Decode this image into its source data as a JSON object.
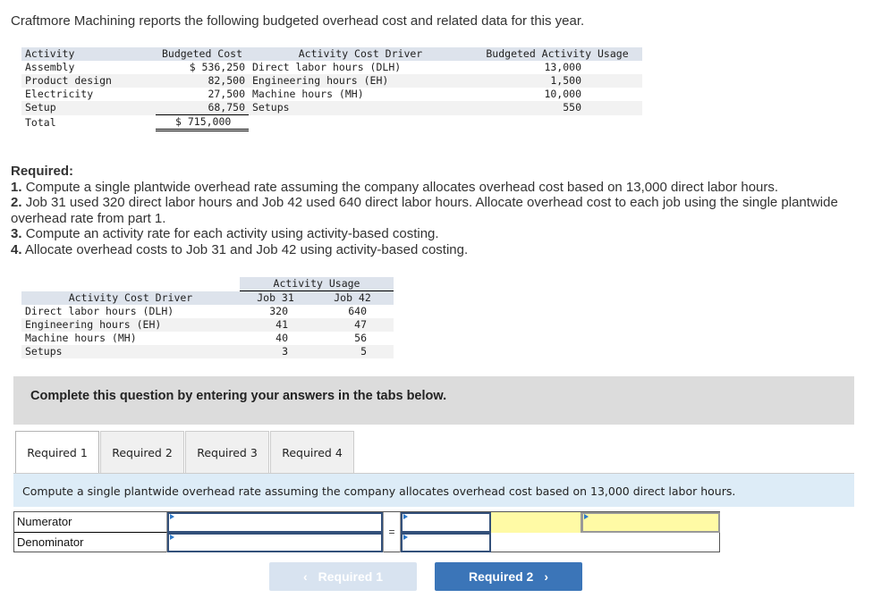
{
  "intro": "Craftmore Machining reports the following budgeted overhead cost and related data for this year.",
  "budget_table": {
    "headers": [
      "Activity",
      "Budgeted Cost",
      "Activity Cost Driver",
      "Budgeted Activity Usage"
    ],
    "rows": [
      {
        "activity": "Assembly",
        "cost": "$ 536,250",
        "driver": "Direct labor hours (DLH)",
        "usage": "13,000"
      },
      {
        "activity": "Product design",
        "cost": "82,500",
        "driver": "Engineering hours (EH)",
        "usage": "1,500"
      },
      {
        "activity": "Electricity",
        "cost": "27,500",
        "driver": "Machine hours (MH)",
        "usage": "10,000"
      },
      {
        "activity": "Setup",
        "cost": "68,750",
        "driver": "Setups",
        "usage": "550"
      }
    ],
    "total_label": "Total",
    "total_cost": "$ 715,000"
  },
  "required": {
    "heading": "Required:",
    "items": [
      {
        "num": "1.",
        "text": "Compute a single plantwide overhead rate assuming the company allocates overhead cost based on 13,000 direct labor hours."
      },
      {
        "num": "2.",
        "text": "Job 31 used 320 direct labor hours and Job 42 used 640 direct labor hours. Allocate overhead cost to each job using the single plantwide overhead rate from part 1."
      },
      {
        "num": "3.",
        "text": "Compute an activity rate for each activity using activity-based costing."
      },
      {
        "num": "4.",
        "text": "Allocate overhead costs to Job 31 and Job 42 using activity-based costing."
      }
    ]
  },
  "usage_table": {
    "group_header": "Activity Usage",
    "headers": [
      "Activity Cost Driver",
      "Job 31",
      "Job 42"
    ],
    "rows": [
      {
        "driver": "Direct labor hours (DLH)",
        "job31": "320",
        "job42": "640"
      },
      {
        "driver": "Engineering hours (EH)",
        "job31": "41",
        "job42": "47"
      },
      {
        "driver": "Machine hours (MH)",
        "job31": "40",
        "job42": "56"
      },
      {
        "driver": "Setups",
        "job31": "3",
        "job42": "5"
      }
    ]
  },
  "banner": "Complete this question by entering your answers in the tabs below.",
  "tabs": [
    {
      "label": "Required 1",
      "active": true
    },
    {
      "label": "Required 2",
      "active": false
    },
    {
      "label": "Required 3",
      "active": false
    },
    {
      "label": "Required 4",
      "active": false
    }
  ],
  "question": "Compute a single plantwide overhead rate assuming the company allocates overhead cost based on 13,000 direct labor hours.",
  "form": {
    "numerator_label": "Numerator",
    "denominator_label": "Denominator",
    "equals": "=",
    "numerator_value": "",
    "denominator_value": "",
    "numerator_result": "",
    "denominator_result": "",
    "rate_label": "",
    "rate_value": ""
  },
  "nav": {
    "prev_label": "Required 1",
    "prev_icon": "‹",
    "next_label": "Required 2",
    "next_icon": "›"
  },
  "colors": {
    "accent": "#3b75b8",
    "highlight": "#fffaa5",
    "question_bg": "#ddecf7"
  }
}
